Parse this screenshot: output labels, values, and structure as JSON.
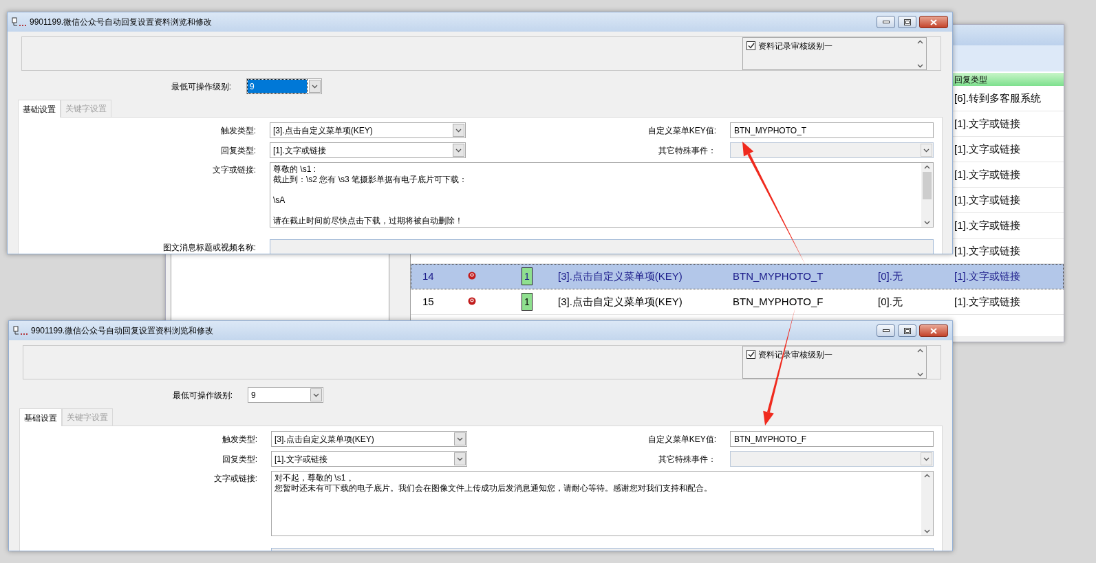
{
  "background_window": {
    "table": {
      "header": "回复类型",
      "rows": [
        {
          "reply_type": "[6].转到多客服系统",
          "selected": false
        },
        {
          "reply_type": "[1].文字或链接",
          "selected": false
        },
        {
          "reply_type": "[1].文字或链接",
          "selected": false
        },
        {
          "reply_type": "[1].文字或链接",
          "selected": false
        },
        {
          "reply_type": "[1].文字或链接",
          "selected": false
        },
        {
          "reply_type": "[1].文字或链接",
          "selected": false
        },
        {
          "reply_type": "[1].文字或链接",
          "selected": false
        },
        {
          "no": "14",
          "level": "1",
          "trigger": "[3].点击自定义菜单项(KEY)",
          "key": "BTN_MYPHOTO_T",
          "special": "[0].无",
          "reply_type": "[1].文字或链接",
          "selected": true
        },
        {
          "no": "15",
          "level": "1",
          "trigger": "[3].点击自定义菜单项(KEY)",
          "key": "BTN_MYPHOTO_F",
          "special": "[0].无",
          "reply_type": "[1].文字或链接",
          "selected": false
        }
      ]
    }
  },
  "windows": [
    {
      "title": "9901199.微信公众号自动回复设置资料浏览和修改",
      "audit": {
        "label": "资料记录审核级别一",
        "checked": true
      },
      "level": {
        "label": "最低可操作级别:",
        "value": "9",
        "highlighted": true
      },
      "tabs": [
        {
          "label": "基础设置",
          "selected": true
        },
        {
          "label": "关键字设置",
          "selected": false
        }
      ],
      "trigger": {
        "label": "触发类型:",
        "value": "[3].点击自定义菜单项(KEY)"
      },
      "menu_key": {
        "label": "自定义菜单KEY值:",
        "value": "BTN_MYPHOTO_T"
      },
      "reply_type": {
        "label": "回复类型:",
        "value": "[1].文字或链接"
      },
      "special_event": {
        "label": "其它特殊事件：",
        "disabled": true
      },
      "text": {
        "label": "文字或链接:",
        "paragraphs": [
          [
            "尊敬的 \\s1 :",
            "截止到：\\s2 您有 \\s3 笔摄影单据有电子底片可下载："
          ],
          [
            "\\sA"
          ],
          [
            "请在截止时间前尽快点击下载，过期将被自动删除！"
          ]
        ]
      },
      "news_title": {
        "label": "图文消息标题或视频名称:"
      }
    },
    {
      "title": "9901199.微信公众号自动回复设置资料浏览和修改",
      "audit": {
        "label": "资料记录审核级别一",
        "checked": true
      },
      "level": {
        "label": "最低可操作级别:",
        "value": "9",
        "highlighted": false
      },
      "tabs": [
        {
          "label": "基础设置",
          "selected": true
        },
        {
          "label": "关键字设置",
          "selected": false
        }
      ],
      "trigger": {
        "label": "触发类型:",
        "value": "[3].点击自定义菜单项(KEY)"
      },
      "menu_key": {
        "label": "自定义菜单KEY值:",
        "value": "BTN_MYPHOTO_F"
      },
      "reply_type": {
        "label": "回复类型:",
        "value": "[1].文字或链接"
      },
      "special_event": {
        "label": "其它特殊事件：",
        "disabled": true
      },
      "text": {
        "label": "文字或链接:",
        "paragraphs": [
          [
            "对不起，尊敬的 \\s1 。",
            "您暂时还未有可下载的电子底片。我们会在图像文件上传成功后发消息通知您，请耐心等待。感谢您对我们支持和配合。"
          ]
        ]
      }
    }
  ],
  "annotations": [
    {
      "kind": "arrow"
    },
    {
      "kind": "arrow"
    }
  ]
}
